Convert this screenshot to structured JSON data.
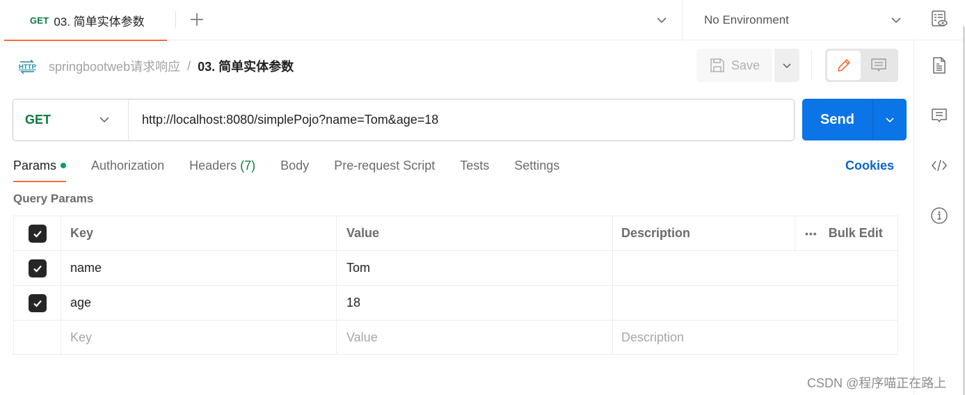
{
  "tab": {
    "method": "GET",
    "title": "03. 简单实体参数"
  },
  "environment": {
    "selected": "No Environment"
  },
  "breadcrumb": {
    "collection": "springbootweb请求响应",
    "separator": "/",
    "current": "03. 简单实体参数"
  },
  "toolbar": {
    "save_label": "Save"
  },
  "request": {
    "method": "GET",
    "url": "http://localhost:8080/simplePojo?name=Tom&age=18",
    "send_label": "Send"
  },
  "request_tabs": [
    {
      "label": "Params",
      "active": true
    },
    {
      "label": "Authorization"
    },
    {
      "label": "Headers",
      "count": "(7)"
    },
    {
      "label": "Body"
    },
    {
      "label": "Pre-request Script"
    },
    {
      "label": "Tests"
    },
    {
      "label": "Settings"
    }
  ],
  "cookies_label": "Cookies",
  "query_params": {
    "section_label": "Query Params",
    "headers": {
      "key": "Key",
      "value": "Value",
      "description": "Description",
      "bulk_edit": "Bulk Edit"
    },
    "rows": [
      {
        "enabled": true,
        "key": "name",
        "value": "Tom",
        "description": ""
      },
      {
        "enabled": true,
        "key": "age",
        "value": "18",
        "description": ""
      }
    ],
    "placeholders": {
      "key": "Key",
      "value": "Value",
      "description": "Description"
    }
  },
  "colors": {
    "accent": "#f26b3a",
    "send": "#0b74e6",
    "method_get": "#0c7a3e",
    "link": "#0b62c9"
  },
  "watermark": "CSDN @程序喵正在路上"
}
